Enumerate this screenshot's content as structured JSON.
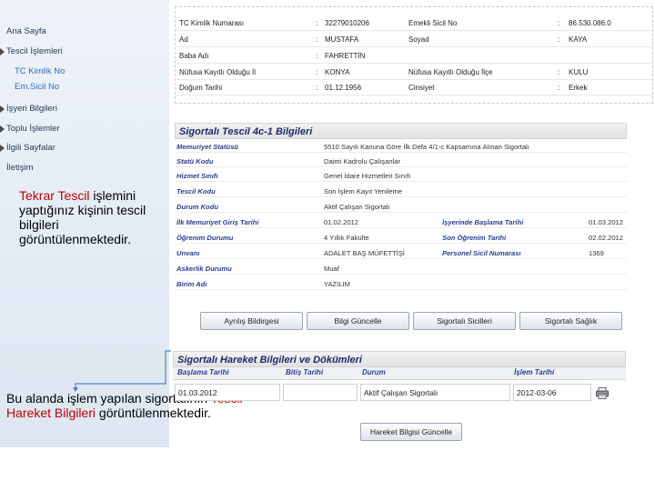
{
  "sidebar": {
    "items": [
      {
        "label": "Ana Sayfa"
      },
      {
        "label": "Tescil İşlemleri"
      },
      {
        "label": "TC Kimlik No"
      },
      {
        "label": "Em.Sicil No"
      },
      {
        "label": "İşyeri Bilgileri"
      },
      {
        "label": "Toplu İşlemler"
      },
      {
        "label": "İlgili Sayfalar"
      },
      {
        "label": "İletişim"
      }
    ]
  },
  "notes": {
    "top": {
      "prefix": "",
      "highlight": "Tekrar Tescil",
      "rest": " işlemini yaptığınız kişinin tescil bilgileri görüntülenmektedir."
    },
    "bottom": {
      "prefix": "Bu alanda işlem yapılan sigortalının ",
      "highlight": "Tescil Hareket Bilgileri",
      "rest": " görüntülenmektedir."
    }
  },
  "identity": {
    "rows": [
      {
        "l1": "TC Kimlik Numarası",
        "v1": "32279010206",
        "l2": "Emekli Sicil No",
        "v2": "86.530.086.0"
      },
      {
        "l1": "Ad",
        "v1": "MUSTAFA",
        "l2": "Soyad",
        "v2": "KAYA"
      },
      {
        "l1": "Baba Adı",
        "v1": "FAHRETTİN",
        "l2": "",
        "v2": ""
      },
      {
        "l1": "Nüfusa Kayıtlı Olduğu İl",
        "v1": "KONYA",
        "l2": "Nüfusa Kayıtlı Olduğu İlçe",
        "v2": "KULU"
      },
      {
        "l1": "Doğum Tarihi",
        "v1": "01.12.1956",
        "l2": "Cinsiyet",
        "v2": "Erkek"
      }
    ],
    "separator": ":"
  },
  "details": {
    "title": "Sigortalı Tescil 4c-1 Bilgileri",
    "rows": [
      {
        "l1": "Memuriyet Statüsü",
        "v1": "5510 Sayılı Kanuna Göre İlk Defa 4/1-c Kapsamına Alınan Sigortalı",
        "l2": "",
        "v2": ""
      },
      {
        "l1": "Statü Kodu",
        "v1": "Daimi Kadrolu Çalışanlar",
        "l2": "",
        "v2": ""
      },
      {
        "l1": "Hizmet Sınıfı",
        "v1": "Genel İdare Hizmetleri Sınıfı",
        "l2": "",
        "v2": ""
      },
      {
        "l1": "Tescil Kodu",
        "v1": "Son İşlem Kayıt Yenileme",
        "l2": "",
        "v2": ""
      },
      {
        "l1": "Durum Kodu",
        "v1": "Aktif Çalışan Sigortalı",
        "l2": "",
        "v2": ""
      },
      {
        "l1": "İlk Memuriyet Giriş Tarihi",
        "v1": "01.02.2012",
        "l2": "İşyerinde Başlama Tarihi",
        "v2": "01.03.2012"
      },
      {
        "l1": "Öğrenim Durumu",
        "v1": "4 Yıllık Fakülte",
        "l2": "Son Öğrenim Tarihi",
        "v2": "02.02.2012"
      },
      {
        "l1": "Unvanı",
        "v1": "ADALET BAŞ MÜFETTİŞİ",
        "l2": "Personel Sicil Numarası",
        "v2": "1369"
      },
      {
        "l1": "Askerlik Durumu",
        "v1": "Muaf",
        "l2": "",
        "v2": ""
      },
      {
        "l1": "Birim Adı",
        "v1": "YAZILIM",
        "l2": "",
        "v2": ""
      }
    ]
  },
  "buttons": {
    "ayrilis": "Ayrılış Bildirgesi",
    "bilgi_guncelle": "Bilgi Güncelle",
    "sicilleri": "Sigortalı Sicilleri",
    "saglik": "Sigortalı Sağlık",
    "hareket_guncelle": "Hareket Bilgisi Güncelle"
  },
  "movements": {
    "title": "Sigortalı Hareket Bilgileri ve Dökümleri",
    "headers": [
      "Başlama Tarihi",
      "Bitiş Tarihi",
      "Durum",
      "İşlem Tarihi"
    ],
    "rows": [
      {
        "baslama": "01.03.2012",
        "bitis": "",
        "durum": "Aktif Çalışan Sigortalı",
        "islem": "2012-03-06"
      }
    ]
  }
}
